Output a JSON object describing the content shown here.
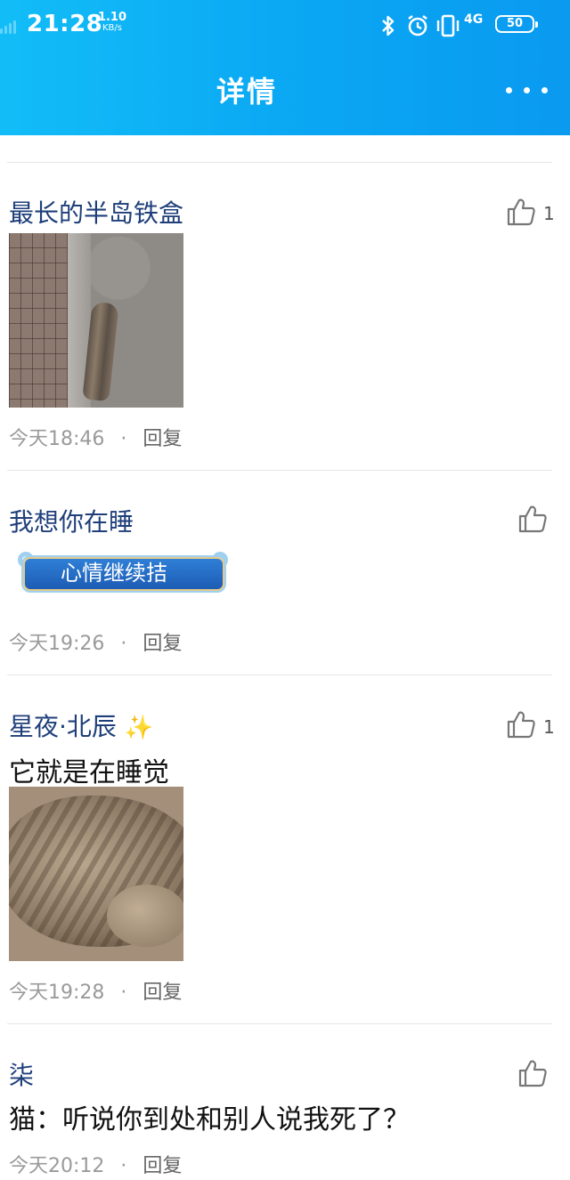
{
  "status_bar": {
    "time": "21:28",
    "net_speed_value": "1.10",
    "net_speed_unit": "KB/s",
    "network": "4G",
    "battery": "50",
    "icons": [
      "bluetooth-icon",
      "alarm-icon",
      "vibrate-icon",
      "4g-signal-icon",
      "battery-icon"
    ]
  },
  "header": {
    "title": "详情",
    "more_icon": "more-dots-icon",
    "background": "#0aa6f3"
  },
  "comments": [
    {
      "author": "最长的半岛铁盒",
      "text": "",
      "has_image": true,
      "image_description_icon": "cat-on-curb-photo",
      "likes": "1",
      "time": "今天18:46",
      "reply": "回复"
    },
    {
      "author": "我想你在睡",
      "text": "",
      "badge_text": "心情继续拮",
      "likes": "",
      "time": "今天19:26",
      "reply": "回复"
    },
    {
      "author": "星夜·北辰",
      "author_emoji": "✨",
      "text": "它就是在睡觉",
      "has_image": true,
      "image_description_icon": "sleeping-cat-photo",
      "likes": "1",
      "time": "今天19:28",
      "reply": "回复"
    },
    {
      "author": "柒",
      "text": "猫：听说你到处和别人说我死了？",
      "likes": "",
      "time": "今天20:12",
      "reply": "回复"
    }
  ],
  "colors": {
    "author": "#1f3f7a",
    "meta": "#9a9a9a",
    "divider": "#e6e6e6"
  }
}
